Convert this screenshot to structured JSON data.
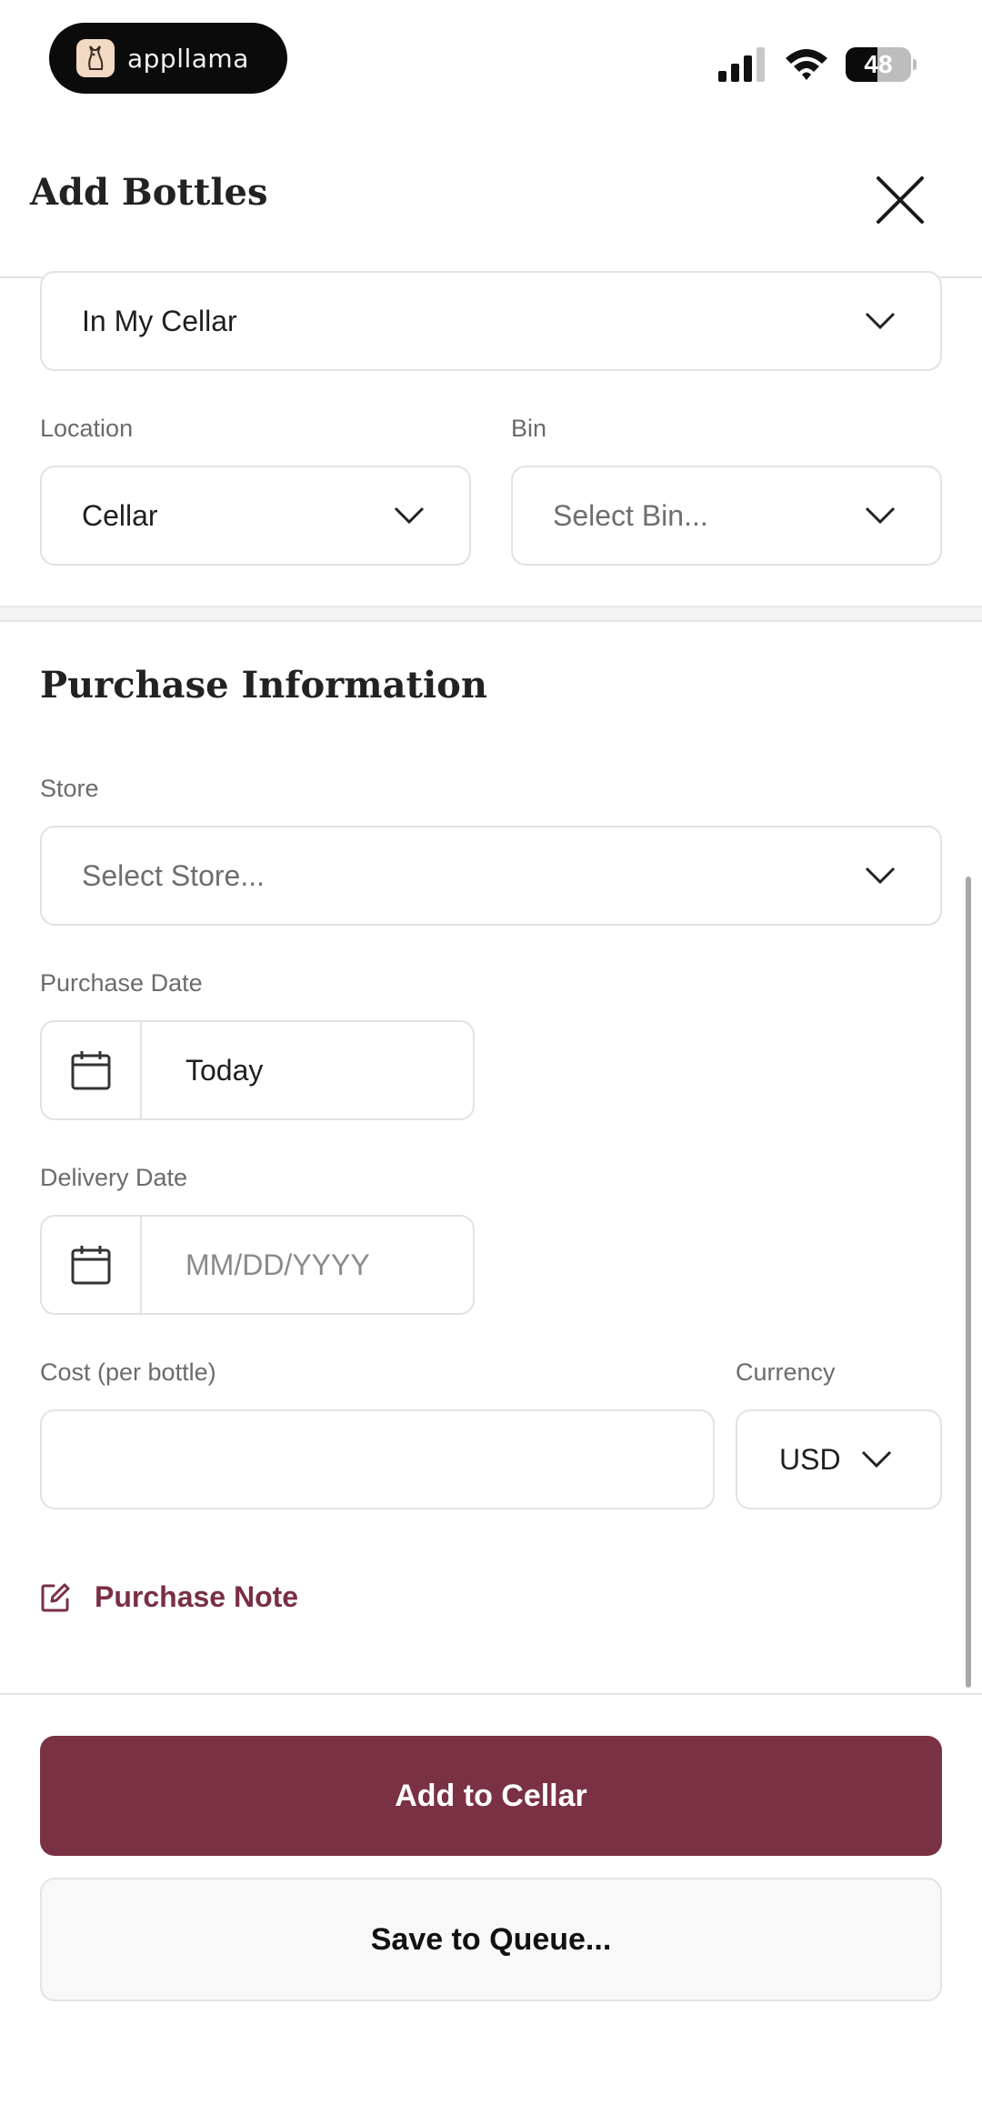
{
  "status_bar": {
    "app_name": "appllama",
    "battery_level": "48",
    "battery_fraction": 0.48
  },
  "header": {
    "title": "Add Bottles"
  },
  "status_select": {
    "value": "In My Cellar"
  },
  "location": {
    "label": "Location",
    "value": "Cellar"
  },
  "bin": {
    "label": "Bin",
    "placeholder": "Select Bin..."
  },
  "purchase": {
    "section_title": "Purchase Information",
    "store_label": "Store",
    "store_placeholder": "Select Store...",
    "purchase_date_label": "Purchase Date",
    "purchase_date_value": "Today",
    "delivery_date_label": "Delivery Date",
    "delivery_date_placeholder": "MM/DD/YYYY",
    "cost_label": "Cost (per bottle)",
    "cost_value": "",
    "currency_label": "Currency",
    "currency_value": "USD",
    "note_link": "Purchase Note"
  },
  "actions": {
    "primary": "Add to Cellar",
    "secondary": "Save to Queue..."
  },
  "colors": {
    "accent": "#7a3144",
    "link": "#7a2f44"
  },
  "icons": {
    "close": "close-icon",
    "chevron": "chevron-down-icon",
    "calendar": "calendar-icon",
    "edit": "edit-note-icon"
  }
}
